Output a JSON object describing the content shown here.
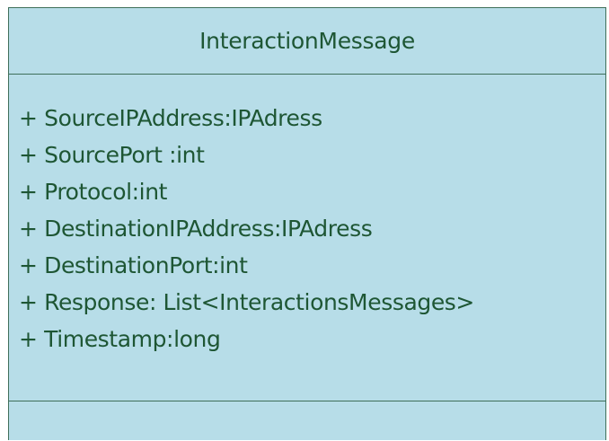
{
  "class_box": {
    "name": "InteractionMessage",
    "attributes": [
      "+ SourceIPAddress:IPAdress",
      "+ SourcePort :int",
      "+ Protocol:int",
      "+ DestinationIPAddress:IPAdress",
      "+ DestinationPort:int",
      "+ Response: List<InteractionsMessages>",
      "+ Timestamp:long"
    ],
    "operations": []
  },
  "colors": {
    "fill": "#b7dde8",
    "border": "#3f6f5a",
    "text": "#1e5634"
  }
}
